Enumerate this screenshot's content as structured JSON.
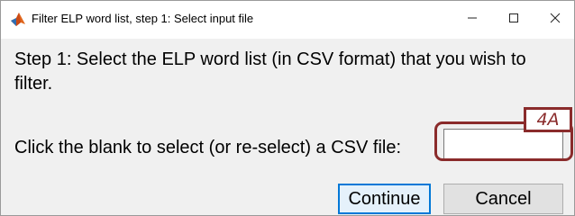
{
  "window": {
    "title": "Filter ELP word list, step 1: Select input file",
    "app_icon": "matlab-icon",
    "controls": {
      "minimize_icon": "minimize-icon",
      "maximize_icon": "maximize-icon",
      "close_icon": "close-icon"
    }
  },
  "content": {
    "instruction": "Step 1: Select the ELP word list (in CSV format) that you wish to filter.",
    "prompt": "Click the blank to select (or re-select) a CSV file:",
    "file_input": {
      "value": "",
      "placeholder": ""
    },
    "callout_label": "4A"
  },
  "buttons": {
    "continue_label": "Continue",
    "cancel_label": "Cancel"
  },
  "colors": {
    "accent": "#0078d7",
    "callout": "#8a2b2b"
  }
}
